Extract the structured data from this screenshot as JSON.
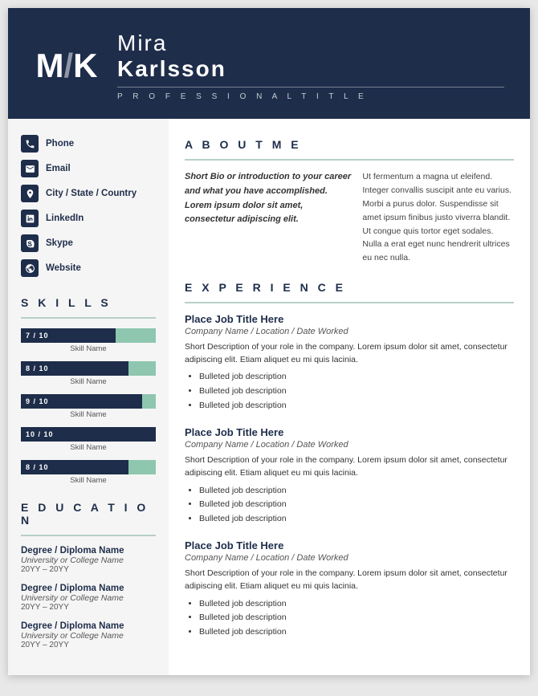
{
  "header": {
    "initials_left": "M",
    "initials_right": "K",
    "first_name": "Mira",
    "last_name": "Karlsson",
    "title": "P R O F E S S I O N A L   T I T L E"
  },
  "contact": {
    "phone_label": "Phone",
    "email_label": "Email",
    "location_label": "City / State / Country",
    "linkedin_label": "LinkedIn",
    "skype_label": "Skype",
    "website_label": "Website"
  },
  "about": {
    "section_title": "A B O U T   M E",
    "bio_left": "Short Bio or introduction to your career and what you have accomplished. Lorem ipsum dolor sit amet, consectetur adipiscing elit.",
    "bio_right": "Ut fermentum a magna ut eleifend. Integer convallis suscipit ante eu varius. Morbi a purus dolor. Suspendisse sit amet ipsum finibus justo viverra blandit. Ut congue quis tortor eget sodales. Nulla a erat eget nunc hendrerit ultrices eu nec nulla."
  },
  "skills": {
    "section_title": "S K I L L S",
    "items": [
      {
        "name": "Skill Name",
        "score": 7,
        "max": 10,
        "label": "7 / 10"
      },
      {
        "name": "Skill Name",
        "score": 8,
        "max": 10,
        "label": "8 / 10"
      },
      {
        "name": "Skill Name",
        "score": 9,
        "max": 10,
        "label": "9 / 10"
      },
      {
        "name": "Skill Name",
        "score": 10,
        "max": 10,
        "label": "10 / 10"
      },
      {
        "name": "Skill Name",
        "score": 8,
        "max": 10,
        "label": "8 / 10"
      }
    ]
  },
  "education": {
    "section_title": "E D U C A T I O N",
    "items": [
      {
        "degree": "Degree / Diploma Name",
        "school": "University or College Name",
        "year": "20YY – 20YY"
      },
      {
        "degree": "Degree / Diploma Name",
        "school": "University or College Name",
        "year": "20YY – 20YY"
      },
      {
        "degree": "Degree / Diploma Name",
        "school": "University or College Name",
        "year": "20YY – 20YY"
      }
    ]
  },
  "experience": {
    "section_title": "E X P E R I E N C E",
    "items": [
      {
        "title": "Place Job Title Here",
        "company": "Company Name / Location / Date Worked",
        "desc": "Short Description of your role in the company. Lorem ipsum dolor sit amet, consectetur adipiscing elit. Etiam aliquet eu mi quis lacinia.",
        "bullets": [
          "Bulleted job description",
          "Bulleted job description",
          "Bulleted job description"
        ]
      },
      {
        "title": "Place Job Title Here",
        "company": "Company Name / Location / Date Worked",
        "desc": "Short Description of your role in the company. Lorem ipsum dolor sit amet, consectetur adipiscing elit. Etiam aliquet eu mi quis lacinia.",
        "bullets": [
          "Bulleted job description",
          "Bulleted job description",
          "Bulleted job description"
        ]
      },
      {
        "title": "Place Job Title Here",
        "company": "Company Name / Location / Date Worked",
        "desc": "Short Description of your role in the company. Lorem ipsum dolor sit amet, consectetur adipiscing elit. Etiam aliquet eu mi quis lacinia.",
        "bullets": [
          "Bulleted job description",
          "Bulleted job description",
          "Bulleted job description"
        ]
      }
    ]
  },
  "colors": {
    "navy": "#1e2d4a",
    "mint": "#8ec6b0",
    "mint_light": "#b8d0c8"
  }
}
